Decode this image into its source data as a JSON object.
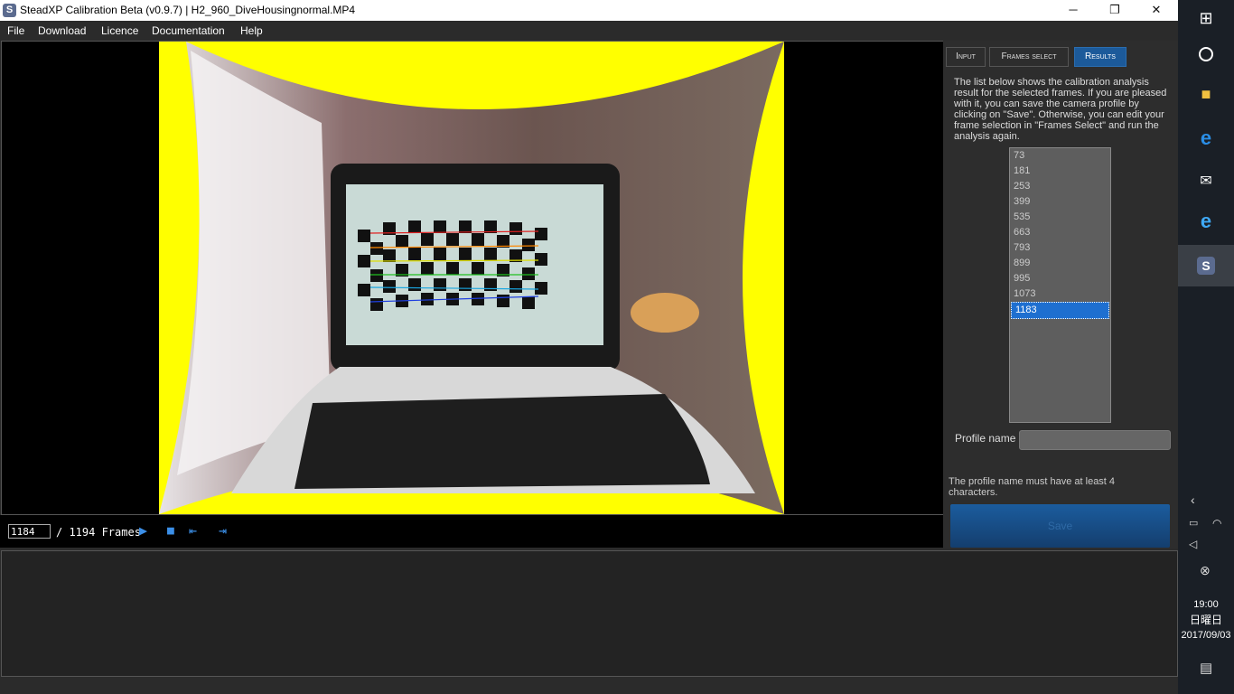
{
  "window": {
    "title": "SteadXP Calibration Beta (v0.9.7) | H2_960_DiveHousingnormal.MP4",
    "app_icon_letter": "S",
    "minimize_glyph": "─",
    "maximize_glyph": "❐",
    "close_glyph": "✕"
  },
  "menu": [
    "File",
    "Download",
    "Licence",
    "Documentation",
    "Help"
  ],
  "playback": {
    "current_frame": "1184",
    "total_label": "/ 1194 Frames",
    "play_icon": "play-icon",
    "stop_icon": "stop-icon",
    "prev_icon": "skip-back-icon",
    "next_icon": "skip-forward-icon"
  },
  "tabs": [
    {
      "label": "Input",
      "active": false
    },
    {
      "label": "Frames select",
      "active": false
    },
    {
      "label": "Results",
      "active": true
    }
  ],
  "results": {
    "description": "The list below shows the calibration analysis result for the selected frames. If you are pleased with it, you can save the camera profile by clicking on \"Save\". Otherwise, you can edit your frame selection in \"Frames Select\" and run the analysis again.",
    "frames": [
      "73",
      "181",
      "253",
      "399",
      "535",
      "663",
      "793",
      "899",
      "995",
      "1073",
      "1183"
    ],
    "selected_frame": "1183",
    "profile_label": "Profile name",
    "profile_value": "",
    "warning": "The profile name must have at least 4 characters.",
    "save_label": "Save"
  },
  "taskbar": {
    "time": "19:00",
    "day": "日曜日",
    "date": "2017/09/03"
  },
  "colors": {
    "accent": "#1c5a9a",
    "lens_border": "#ffff00",
    "playback_icons": "#3b8fe8"
  }
}
